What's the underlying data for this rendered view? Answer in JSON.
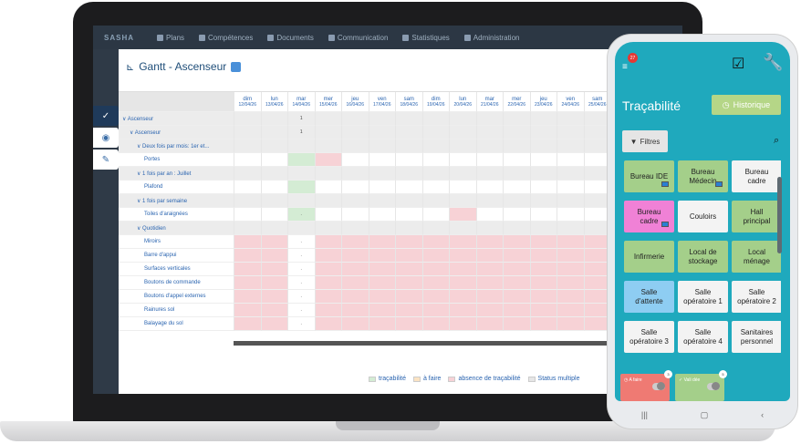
{
  "laptop": {
    "nav": {
      "logo": "SASHA",
      "items": [
        "Plans",
        "Compétences",
        "Documents",
        "Communication",
        "Statistiques",
        "Administration"
      ]
    },
    "side_tools": [
      "check",
      "eye",
      "wrench"
    ],
    "panel": {
      "title": "Gantt - Ascenseur",
      "header_days": [
        {
          "day": "dim",
          "date": "12/04/26"
        },
        {
          "day": "lun",
          "date": "13/04/26"
        },
        {
          "day": "mar",
          "date": "14/04/26"
        },
        {
          "day": "mer",
          "date": "15/04/26"
        },
        {
          "day": "jeu",
          "date": "16/04/26"
        },
        {
          "day": "ven",
          "date": "17/04/26"
        },
        {
          "day": "sam",
          "date": "18/04/26"
        },
        {
          "day": "dim",
          "date": "19/04/26"
        },
        {
          "day": "lun",
          "date": "20/04/26"
        },
        {
          "day": "mar",
          "date": "21/04/26"
        },
        {
          "day": "mer",
          "date": "22/04/26"
        },
        {
          "day": "jeu",
          "date": "23/04/26"
        },
        {
          "day": "ven",
          "date": "24/04/26"
        },
        {
          "day": "sam",
          "date": "25/04/26"
        }
      ],
      "rows": [
        {
          "label": "∨ Ascenseur",
          "group": true,
          "marks": {
            "2": "1"
          }
        },
        {
          "label": "∨ Ascenseur",
          "group": true,
          "indent": 1,
          "marks": {
            "2": "1"
          }
        },
        {
          "label": "∨ Deux fois par mois: 1er et...",
          "group": true,
          "indent": 2
        },
        {
          "label": "Portes",
          "indent": 3,
          "green": [
            2
          ],
          "red": [
            3
          ]
        },
        {
          "label": "∨ 1 fois par an : Juillet",
          "group": true,
          "indent": 2
        },
        {
          "label": "Plafond",
          "indent": 3,
          "green": [
            2
          ]
        },
        {
          "label": "∨ 1 fois par semaine",
          "group": true,
          "indent": 2
        },
        {
          "label": "Toiles d'araignées",
          "indent": 3,
          "green": [
            2
          ],
          "red": [
            8
          ],
          "marks": {
            "2": "."
          }
        },
        {
          "label": "∨ Quotidien",
          "group": true,
          "indent": 2
        },
        {
          "label": "Miroirs",
          "indent": 3,
          "allred": true,
          "marks": {
            "2": "."
          }
        },
        {
          "label": "Barre d'appui",
          "indent": 3,
          "allred": true,
          "marks": {
            "2": "."
          }
        },
        {
          "label": "Surfaces verticales",
          "indent": 3,
          "allred": true,
          "marks": {
            "2": "."
          }
        },
        {
          "label": "Boutons de commande",
          "indent": 3,
          "allred": true,
          "marks": {
            "2": "."
          }
        },
        {
          "label": "Boutons d'appel externes",
          "indent": 3,
          "allred": true,
          "marks": {
            "2": "."
          }
        },
        {
          "label": "Rainures sol",
          "indent": 3,
          "allred": true,
          "marks": {
            "2": "."
          }
        },
        {
          "label": "Balayage du sol",
          "indent": 3,
          "allred": true,
          "marks": {
            "2": "."
          }
        }
      ],
      "legend": [
        {
          "label": "traçabilité",
          "color": "#d4ecd4"
        },
        {
          "label": "à faire",
          "color": "#fbe3c2"
        },
        {
          "label": "absence de traçabilité",
          "color": "#f7d2d6"
        },
        {
          "label": "Status multiple",
          "color": "#e6e6e6"
        }
      ]
    }
  },
  "phone": {
    "notification_count": "27",
    "title": "Traçabilité",
    "history_label": "Historique",
    "filter_label": "Filtres",
    "tiles": [
      {
        "label": "Bureau IDE",
        "color": "green",
        "col": 0,
        "row": 0,
        "screen": true
      },
      {
        "label": "Bureau Médecin",
        "color": "green",
        "col": 1,
        "row": 0,
        "screen": true
      },
      {
        "label": "Bureau cadre",
        "color": "white",
        "col": 2,
        "row": 0
      },
      {
        "label": "Bureau cadre",
        "color": "pink",
        "col": 0,
        "row": 1,
        "screen": true
      },
      {
        "label": "Couloirs",
        "color": "white",
        "col": 1,
        "row": 1
      },
      {
        "label": "Hall principal",
        "color": "green",
        "col": 2,
        "row": 1
      },
      {
        "label": "Infirmerie",
        "color": "green",
        "col": 0,
        "row": 2
      },
      {
        "label": "Local de stockage",
        "color": "green",
        "col": 1,
        "row": 2
      },
      {
        "label": "Local ménage",
        "color": "green",
        "col": 2,
        "row": 2
      },
      {
        "label": "Salle d'attente",
        "color": "blue",
        "col": 0,
        "row": 3
      },
      {
        "label": "Salle opératoire 1",
        "color": "white",
        "col": 1,
        "row": 3
      },
      {
        "label": "Salle opératoire 2",
        "color": "white",
        "col": 2,
        "row": 3
      },
      {
        "label": "Salle opératoire 3",
        "color": "white",
        "col": 0,
        "row": 4
      },
      {
        "label": "Salle opératoire 4",
        "color": "white",
        "col": 1,
        "row": 4
      },
      {
        "label": "Sanitaires personnel",
        "color": "white",
        "col": 2,
        "row": 4
      }
    ],
    "bottom": {
      "todo_label": "A faire",
      "todo_count": "3",
      "validate_label": "Vali dée",
      "validate_count": "5"
    }
  }
}
